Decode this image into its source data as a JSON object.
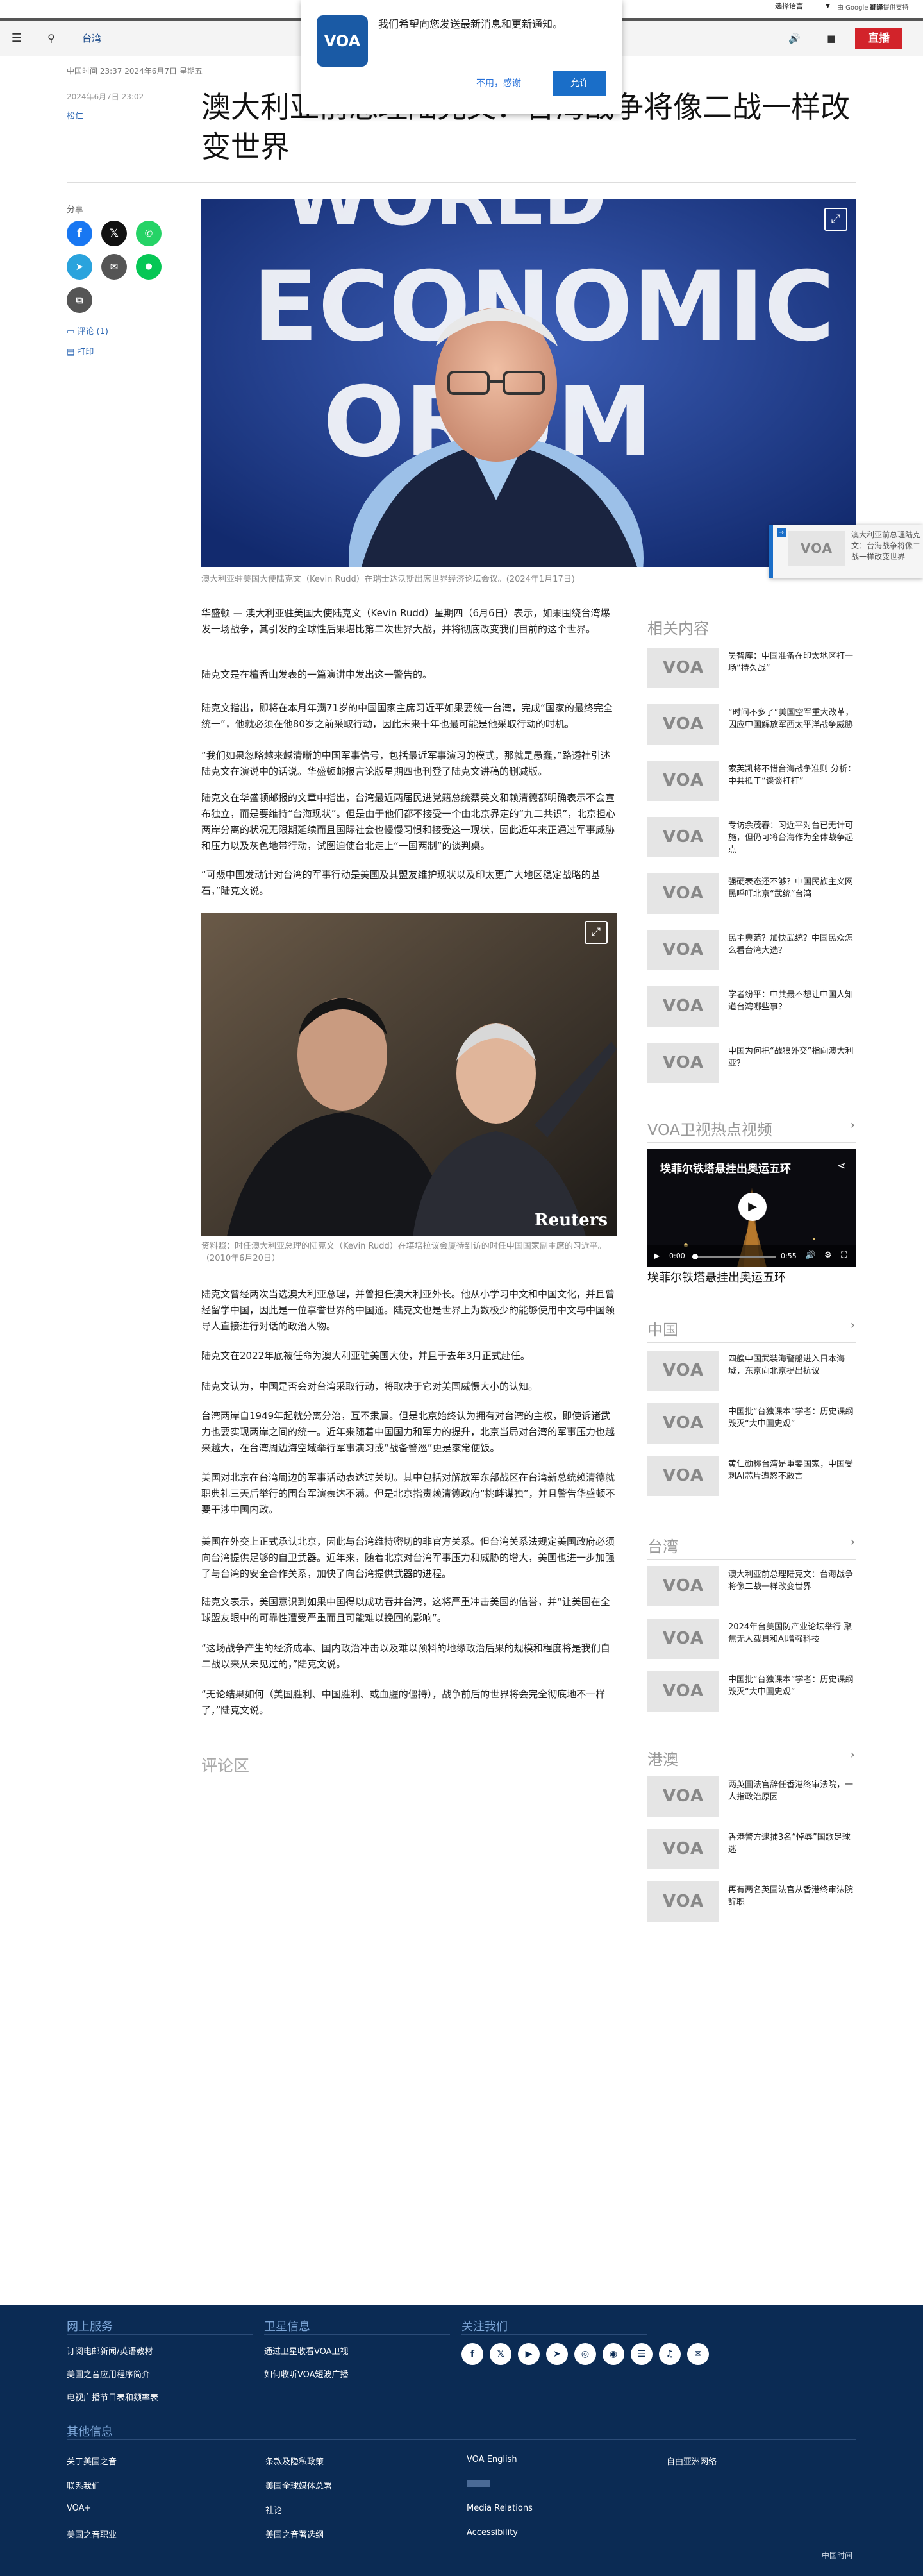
{
  "topbar": {
    "lang_select": "选择语言",
    "gt_prefix": "由 Google ",
    "gt_brand": "翻译",
    "gt_suffix": "提供支持"
  },
  "header": {
    "section": "台湾",
    "live": "直播"
  },
  "notify": {
    "logo": "VOA",
    "text": "我们希望向您发送最新消息和更新通知。",
    "deny": "不用，感谢",
    "allow": "允许"
  },
  "article": {
    "dateline": "中国时间 23:37 2024年6月7日 星期五",
    "pubdate": "2024年6月7日 23:02",
    "author": "松仁",
    "title": "澳大利亚前总理陆克文：台海战争将像二战一样改变世界",
    "hero_caption": "澳大利亚驻美国大使陆克文（Kevin Rudd）在瑞士达沃斯出席世界经济论坛会议。(2024年1月17日)",
    "paragraphs": [
      "华盛顿 — 澳大利亚驻美国大使陆克文（Kevin Rudd）星期四（6月6日）表示，如果围绕台湾爆发一场战争，其引发的全球性后果堪比第二次世界大战，并将彻底改变我们目前的这个世界。",
      "陆克文是在檀香山发表的一篇演讲中发出这一警告的。",
      "陆克文指出，即将在本月年满71岁的中国国家主席习近平如果要统一台湾，完成“国家的最终完全统一”，他就必须在他80岁之前采取行动，因此未来十年也最可能是他采取行动的时机。",
      "“我们如果忽略越来越清晰的中国军事信号，包括最近军事演习的模式，那就是愚蠢，”路透社引述陆克文在演说中的话说。华盛顿邮报言论版星期四也刊登了陆克文讲稿的删减版。",
      "陆克文在华盛顿邮报的文章中指出，台湾最近两届民进党籍总统蔡英文和赖清德都明确表示不会宣布独立，而是要维持“台海现状”。但是由于他们都不接受一个由北京界定的“九二共识”，北京担心两岸分离的状况无限期延续而且国际社会也慢慢习惯和接受这一现状，因此近年来正通过军事威胁和压力以及灰色地带行动，试图迫使台北走上“一国两制”的谈判桌。",
      "“可悲中国发动针对台湾的军事行动是美国及其盟友维护现状以及印太更广大地区稳定战略的基石，”陆克文说。"
    ],
    "image2_caption": "资料照：时任澳大利亚总理的陆克文（Kevin Rudd）在堪培拉议会厦待到访的时任中国国家副主席的习近平。（2010年6月20日）",
    "reuters": "Reuters",
    "paragraphs2": [
      "陆克文曾经两次当选澳大利亚总理，并曾担任澳大利亚外长。他从小学习中文和中国文化，并且曾经留学中国，因此是一位享誉世界的中国通。陆克文也是世界上为数极少的能够使用中文与中国领导人直接进行对话的政治人物。",
      "陆克文在2022年底被任命为澳大利亚驻美国大使，并且于去年3月正式赴任。",
      "陆克文认为，中国是否会对台湾采取行动，将取决于它对美国威慑大小的认知。",
      "台湾两岸自1949年起就分离分治，互不隶属。但是北京始终认为拥有对台湾的主权，即使诉诸武力也要实现两岸之间的统一。近年来随着中国国力和军力的提升，北京当局对台湾的军事压力也越来越大，在台湾周边海空域举行军事演习或“战备警巡”更是家常便饭。",
      "美国对北京在台湾周边的军事活动表达过关切。其中包括对解放军东部战区在台湾新总统赖清德就职典礼三天后举行的围台军演表达不满。但是北京指责赖清德政府“挑衅谋独”，并且警告华盛顿不要干涉中国内政。",
      "美国在外交上正式承认北京，因此与台湾维持密切的非官方关系。但台湾关系法规定美国政府必须向台湾提供足够的自卫武器。近年来，随着北京对台湾军事压力和威胁的增大，美国也进一步加强了与台湾的安全合作关系，加快了向台湾提供武器的进程。",
      "陆克文表示，美国意识到如果中国得以成功吞并台湾，这将严重冲击美国的信誉，并“让美国在全球盟友眼中的可靠性遭受严重而且可能难以挽回的影响”。",
      "“这场战争产生的经济成本、国内政治冲击以及难以预料的地缘政治后果的规模和程度将是我们自二战以来从未见过的，”陆克文说。",
      "“无论结果如何（美国胜利、中国胜利、或血腥的僵持），战争前后的世界将会完全彻底地不一样了，”陆克文说。"
    ],
    "comments_heading": "评论区"
  },
  "share": {
    "label": "分享",
    "comments": "评论 (1)",
    "print": "打印"
  },
  "float_card": {
    "text": "澳大利亚前总理陆克文：台海战争将像二战一样改变世界"
  },
  "sidebar": {
    "related": {
      "heading": "相关内容",
      "items": [
        "吴智库：中国准备在印太地区打一场“持久战”",
        "“时间不多了”美国空军重大改革，因应中国解放军西太平洋战争威胁",
        "索芙凯将不惜台海战争准则 分析：中共抵于“谈谈打打”",
        "专访余茂春：习近平对台已无计可施，但仍可将台海作为全体战争起点",
        "强硬表态还不够？中国民族主义网民呼吁北京“武统”台湾",
        "民主典范？加快武统？中国民众怎么看台湾大选？",
        "学者纷平：中共最不想让中国人知道台湾哪些事？",
        "中国为何把“战狼外交”指向澳大利亚？"
      ]
    },
    "video": {
      "heading": "VOA卫视热点视频",
      "overlay_title": "埃菲尔铁塔悬挂出奥运五环",
      "time_current": "0:00",
      "time_total": "0:55",
      "title": "埃菲尔铁塔悬挂出奥运五环"
    },
    "china": {
      "heading": "中国",
      "items": [
        "四艘中国武装海警船进入日本海域，东京向北京提出抗议",
        "中国批“台独课本”学者：历史课纲毁灭“大中国史观”",
        "黄仁勋称台湾是重要国家，中国受刺AI芯片遭怒不敢言"
      ]
    },
    "taiwan": {
      "heading": "台湾",
      "items": [
        "澳大利亚前总理陆克文：台海战争将像二战一样改变世界",
        "2024年台美国防产业论坛举行 聚焦无人载具和AI增强科技",
        "中国批“台独课本”学者：历史课纲毁灭“大中国史观”"
      ]
    },
    "hk": {
      "heading": "港澳",
      "items": [
        "两英国法官辞任香港终审法院，一人指政治原因",
        "香港警方逮捕3名“悼辱”国歌足球迷",
        "再有两名英国法官从香港终审法院辞职"
      ]
    }
  },
  "footer": {
    "online_heading": "网上服务",
    "online_links": [
      "订阅电邮新闻/英语教材",
      "美国之音应用程序简介",
      "电视广播节目表和频率表"
    ],
    "sat_heading": "卫星信息",
    "sat_links": [
      "通过卫星收看VOA卫视",
      "如何收听VOA短波广播"
    ],
    "follow_heading": "关注我们",
    "other_heading": "其他信息",
    "col1": [
      "关于美国之音",
      "联系我们",
      "VOA+",
      "美国之音职业"
    ],
    "col2": [
      "条款及隐私政策",
      "美国全球媒体总署",
      "社论",
      "美国之音著选纲"
    ],
    "col3": [
      "VOA English",
      "Media Relations",
      "Accessibility"
    ],
    "col4": [
      "自由亚洲网络"
    ],
    "time": "中国时间"
  }
}
